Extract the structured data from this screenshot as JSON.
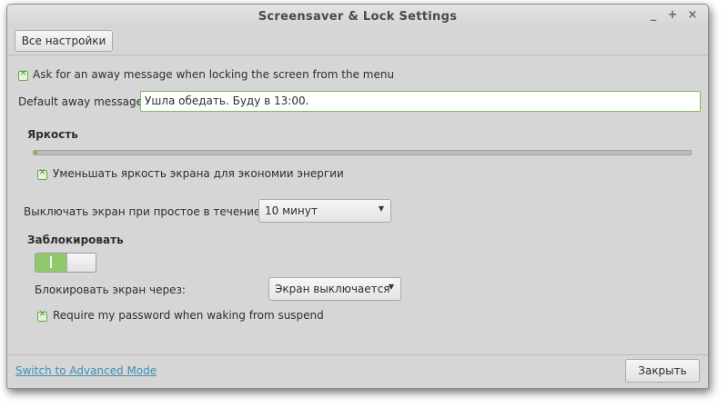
{
  "window": {
    "title": "Screensaver & Lock Settings",
    "controls": [
      "_",
      "+",
      "×"
    ]
  },
  "header": {
    "all_settings_label": "Все настройки"
  },
  "away_message": {
    "checkbox_checked": true,
    "checkbox_label": "Ask for an away message when locking the screen from the menu",
    "field_label": "Default away message",
    "field_value": "Ушла обедать. Буду в 13:00."
  },
  "brightness": {
    "heading": "Яркость",
    "level": 0.0,
    "dim_checkbox_checked": true,
    "dim_checkbox_label": "Уменьшать яркость экрана для экономии энергии"
  },
  "idle": {
    "label": "Выключать экран при простое в течение:",
    "selected": "10 минут"
  },
  "lock": {
    "heading": "Заблокировать",
    "switch_on": true,
    "lock_after_label": "Блокировать экран через:",
    "lock_after_selected": "Экран выключается",
    "require_password_checked": true,
    "require_password_label": "Require my password when waking from suspend"
  },
  "footer": {
    "advanced_mode_link": "Switch to Advanced Mode",
    "close_label": "Закрыть"
  },
  "colors": {
    "accent": "#7cbd4e",
    "link": "#3d8fb3",
    "window_bg": "#d6d6d6"
  }
}
